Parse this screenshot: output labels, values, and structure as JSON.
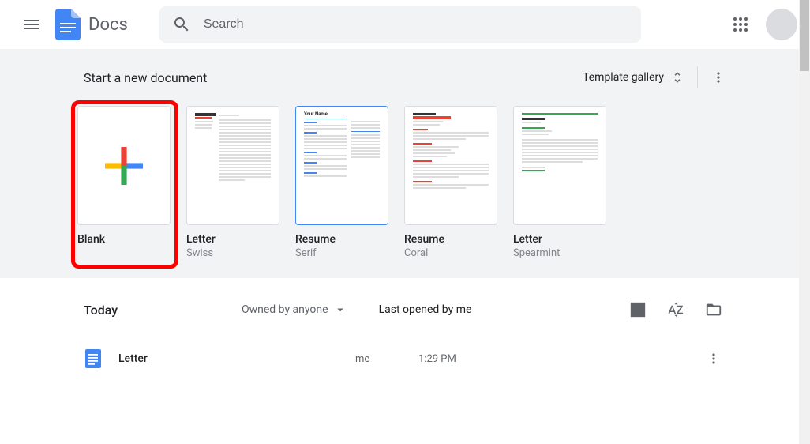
{
  "header": {
    "app_title": "Docs",
    "search_placeholder": "Search"
  },
  "templates": {
    "section_title": "Start a new document",
    "gallery_label": "Template gallery",
    "items": [
      {
        "name": "Blank",
        "sub": ""
      },
      {
        "name": "Letter",
        "sub": "Swiss"
      },
      {
        "name": "Resume",
        "sub": "Serif"
      },
      {
        "name": "Resume",
        "sub": "Coral"
      },
      {
        "name": "Letter",
        "sub": "Spearmint"
      }
    ]
  },
  "list": {
    "section_title": "Today",
    "owner_filter": "Owned by anyone",
    "sort_label": "Last opened by me",
    "rows": [
      {
        "name": "Letter",
        "owner": "me",
        "time": "1:29 PM"
      }
    ]
  }
}
